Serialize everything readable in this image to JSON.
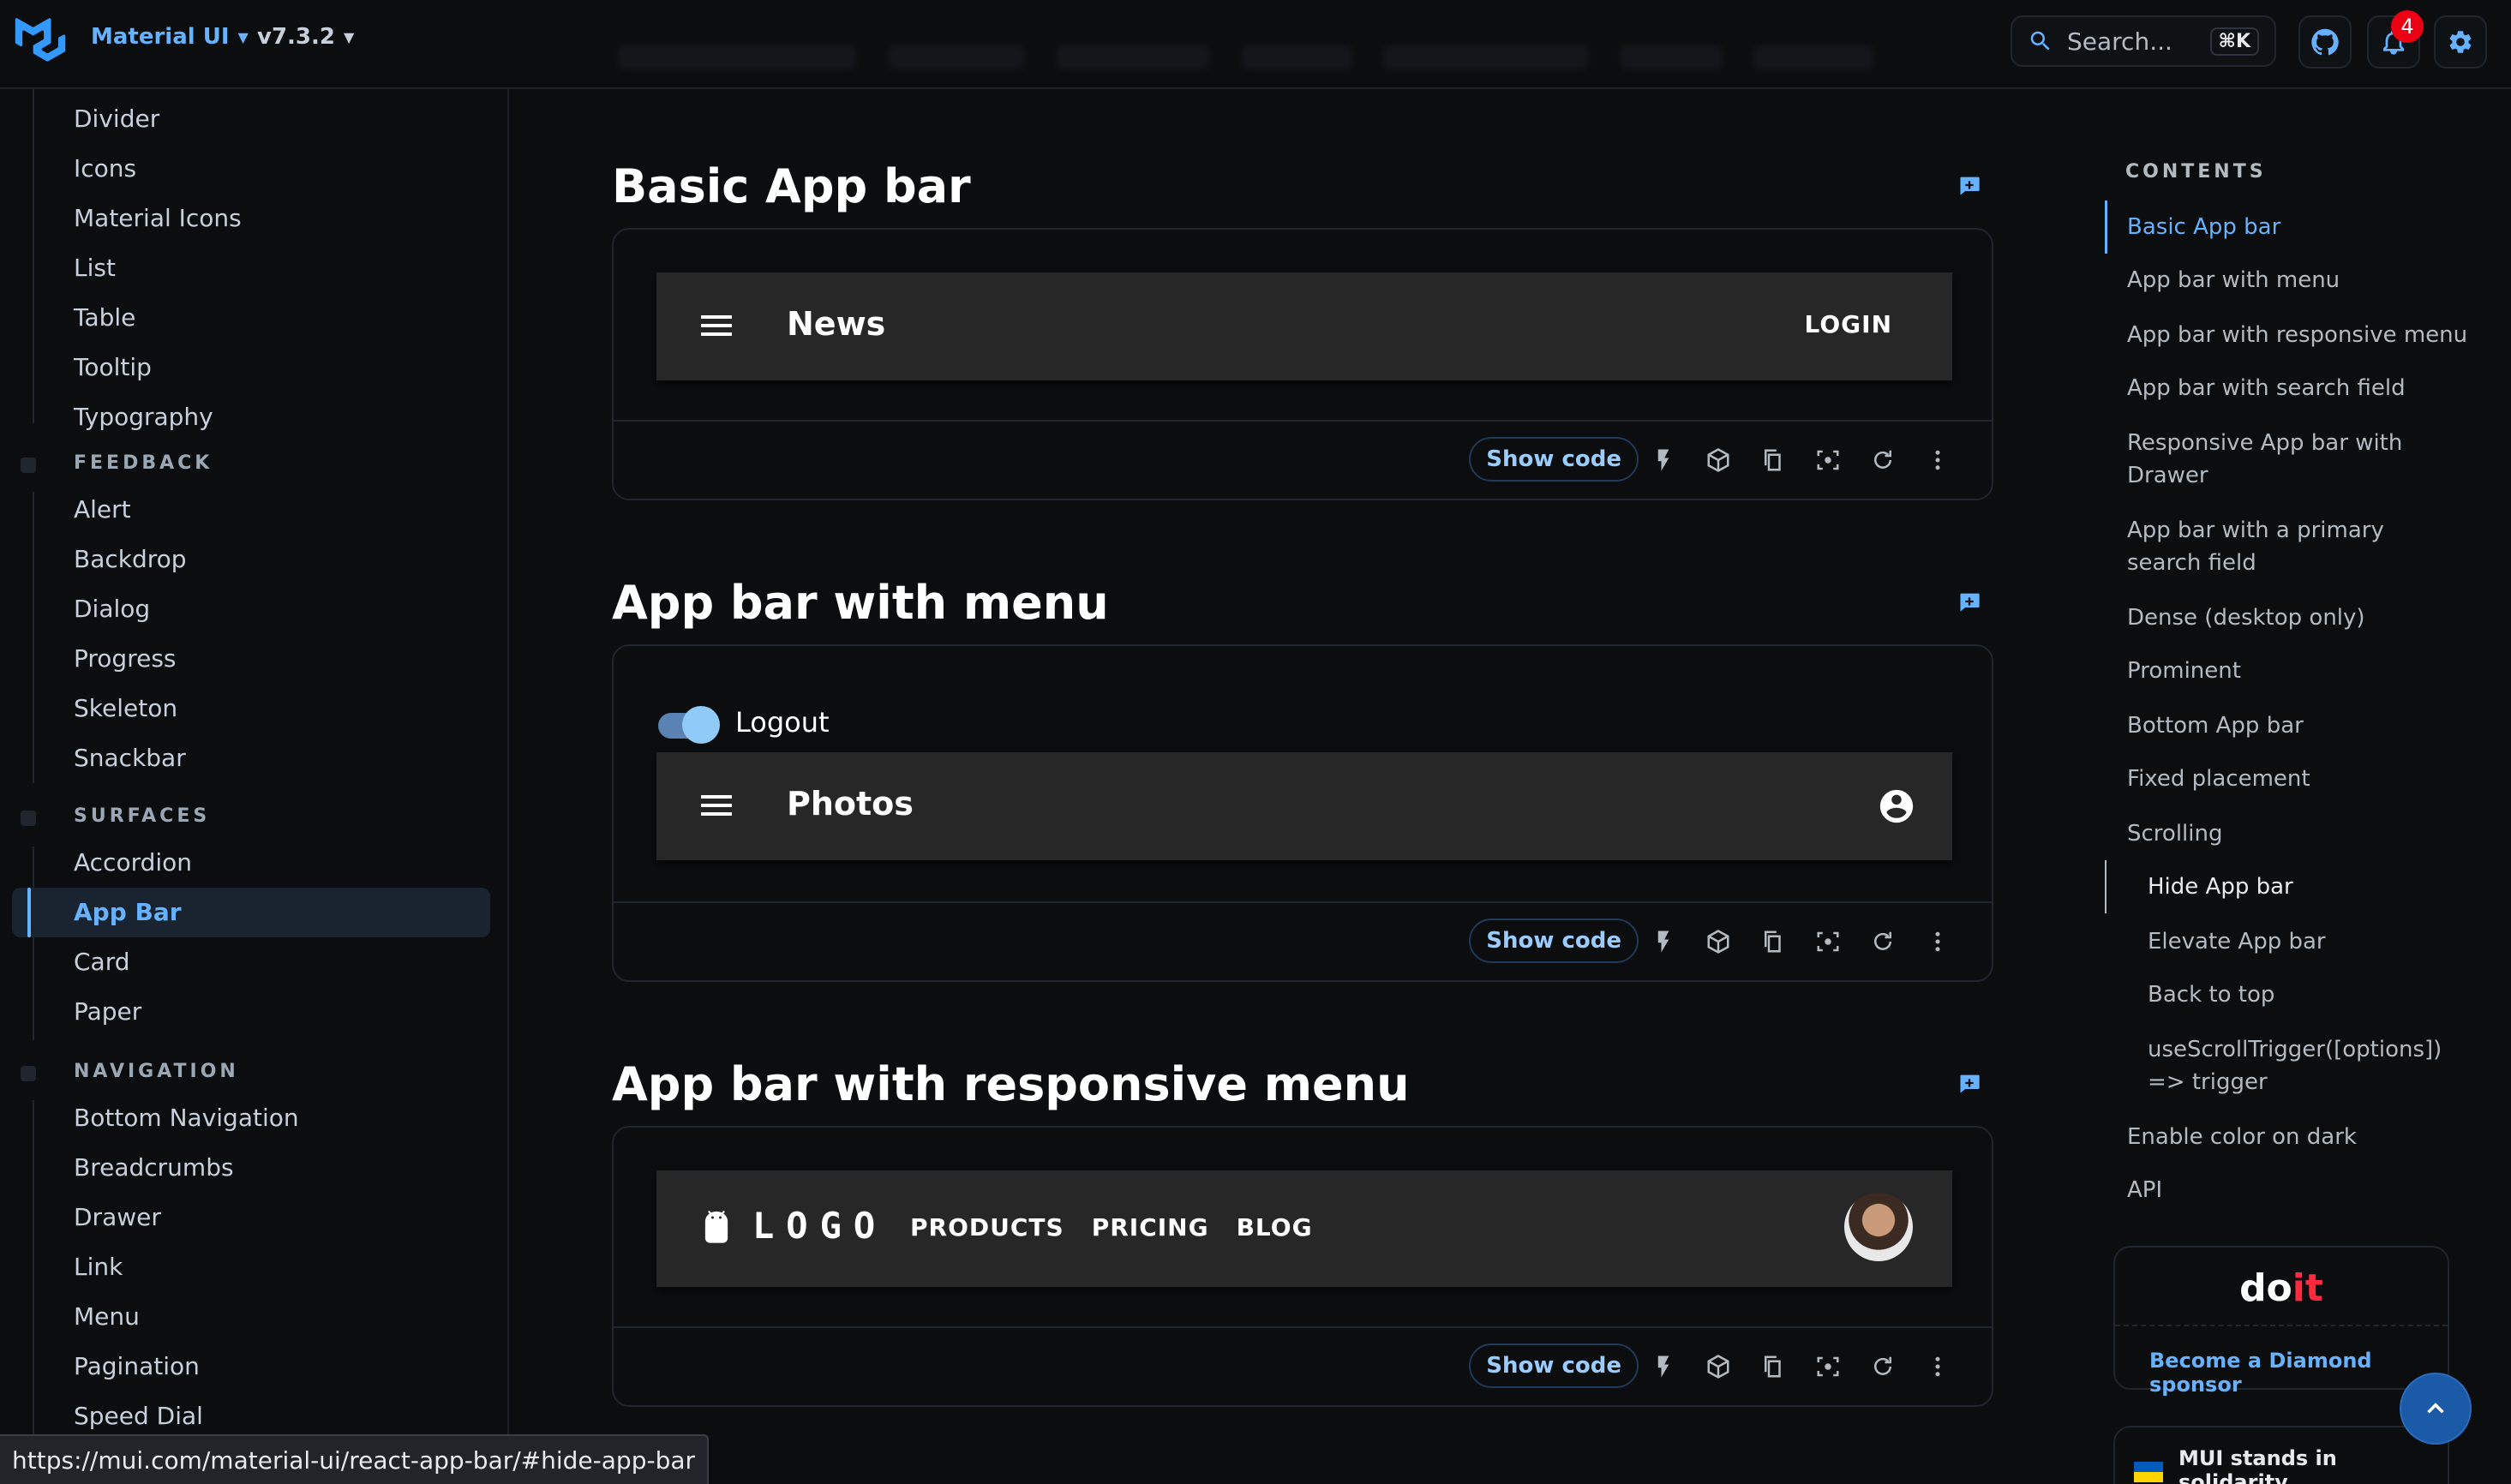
{
  "header": {
    "brand": "Material UI",
    "version": "v7.3.2",
    "search_placeholder": "Search...",
    "search_shortcut": "⌘K",
    "notification_count": "4"
  },
  "sidebar": {
    "items_top": [
      "Divider",
      "Icons",
      "Material Icons",
      "List",
      "Table",
      "Tooltip",
      "Typography"
    ],
    "feedback_title": "FEEDBACK",
    "feedback_items": [
      "Alert",
      "Backdrop",
      "Dialog",
      "Progress",
      "Skeleton",
      "Snackbar"
    ],
    "surfaces_title": "SURFACES",
    "surfaces_items": [
      "Accordion",
      "App Bar",
      "Card",
      "Paper"
    ],
    "navigation_title": "NAVIGATION",
    "navigation_items": [
      "Bottom Navigation",
      "Breadcrumbs",
      "Drawer",
      "Link",
      "Menu",
      "Pagination",
      "Speed Dial"
    ],
    "active_item": "App Bar"
  },
  "sections": [
    {
      "title": "Basic App bar",
      "appbar_title": "News",
      "action": "LOGIN"
    },
    {
      "title": "App bar with menu",
      "switch_label": "Logout",
      "appbar_title": "Photos"
    },
    {
      "title": "App bar with responsive menu",
      "logo": "LOGO",
      "links": [
        "PRODUCTS",
        "PRICING",
        "BLOG"
      ]
    }
  ],
  "demo_toolbar": {
    "show_code": "Show code"
  },
  "toc": {
    "heading": "CONTENTS",
    "items": [
      "Basic App bar",
      "App bar with menu",
      "App bar with responsive menu",
      "App bar with search field",
      "Responsive App bar with Drawer",
      "App bar with a primary search field",
      "Dense (desktop only)",
      "Prominent",
      "Bottom App bar",
      "Fixed placement",
      "Scrolling",
      "Hide App bar",
      "Elevate App bar",
      "Back to top",
      "useScrollTrigger([options]) => trigger",
      "Enable color on dark",
      "API"
    ]
  },
  "sponsor": {
    "logo_a": "do",
    "logo_b": "it",
    "link": "Become a Diamond sponsor"
  },
  "ukraine": {
    "text": "MUI stands in solidarity"
  },
  "status_url": "https://mui.com/material-ui/react-app-bar/#hide-app-bar",
  "colors": {
    "accent": "#66b2ff",
    "background": "#0b0d0e",
    "appbar": "#272727",
    "badge": "#eb0014"
  }
}
